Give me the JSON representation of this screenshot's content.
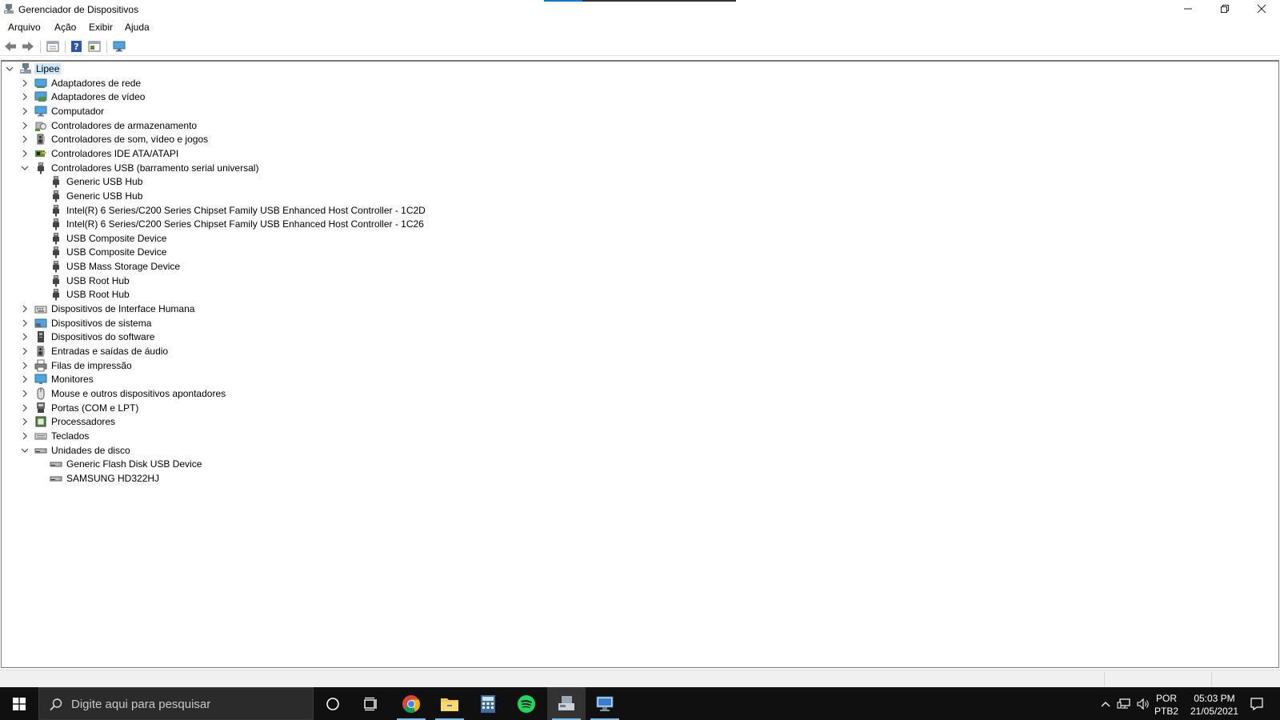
{
  "window": {
    "title": "Gerenciador de Dispositivos"
  },
  "menu": {
    "items": [
      "Arquivo",
      "Ação",
      "Exibir",
      "Ajuda"
    ]
  },
  "tree": {
    "root": "Lipee",
    "nodes": [
      {
        "label": "Adaptadores de rede",
        "level": 1,
        "expander": "collapsed",
        "icon": "network-adapter-icon"
      },
      {
        "label": "Adaptadores de vídeo",
        "level": 1,
        "expander": "collapsed",
        "icon": "display-adapter-icon"
      },
      {
        "label": "Computador",
        "level": 1,
        "expander": "collapsed",
        "icon": "computer-icon"
      },
      {
        "label": "Controladores de armazenamento",
        "level": 1,
        "expander": "collapsed",
        "icon": "storage-controller-icon"
      },
      {
        "label": "Controladores de som, vídeo e jogos",
        "level": 1,
        "expander": "collapsed",
        "icon": "speaker-icon"
      },
      {
        "label": "Controladores IDE ATA/ATAPI",
        "level": 1,
        "expander": "collapsed",
        "icon": "ide-controller-icon"
      },
      {
        "label": "Controladores USB (barramento serial universal)",
        "level": 1,
        "expander": "expanded",
        "icon": "usb-plug-icon"
      },
      {
        "label": "Generic USB Hub",
        "level": 2,
        "expander": "none",
        "icon": "usb-plug-icon"
      },
      {
        "label": "Generic USB Hub",
        "level": 2,
        "expander": "none",
        "icon": "usb-plug-icon"
      },
      {
        "label": "Intel(R) 6 Series/C200 Series Chipset Family USB Enhanced Host Controller - 1C2D",
        "level": 2,
        "expander": "none",
        "icon": "usb-plug-icon"
      },
      {
        "label": "Intel(R) 6 Series/C200 Series Chipset Family USB Enhanced Host Controller - 1C26",
        "level": 2,
        "expander": "none",
        "icon": "usb-plug-icon"
      },
      {
        "label": "USB Composite Device",
        "level": 2,
        "expander": "none",
        "icon": "usb-plug-icon"
      },
      {
        "label": "USB Composite Device",
        "level": 2,
        "expander": "none",
        "icon": "usb-plug-icon"
      },
      {
        "label": "USB Mass Storage Device",
        "level": 2,
        "expander": "none",
        "icon": "usb-plug-icon"
      },
      {
        "label": "USB Root Hub",
        "level": 2,
        "expander": "none",
        "icon": "usb-plug-icon"
      },
      {
        "label": "USB Root Hub",
        "level": 2,
        "expander": "none",
        "icon": "usb-plug-icon"
      },
      {
        "label": "Dispositivos de Interface Humana",
        "level": 1,
        "expander": "collapsed",
        "icon": "hid-keyboard-icon"
      },
      {
        "label": "Dispositivos de sistema",
        "level": 1,
        "expander": "collapsed",
        "icon": "system-device-icon"
      },
      {
        "label": "Dispositivos do software",
        "level": 1,
        "expander": "collapsed",
        "icon": "software-device-icon"
      },
      {
        "label": "Entradas e saídas de áudio",
        "level": 1,
        "expander": "collapsed",
        "icon": "speaker-icon"
      },
      {
        "label": "Filas de impressão",
        "level": 1,
        "expander": "collapsed",
        "icon": "printer-icon"
      },
      {
        "label": "Monitores",
        "level": 1,
        "expander": "collapsed",
        "icon": "monitor-icon"
      },
      {
        "label": "Mouse e outros dispositivos apontadores",
        "level": 1,
        "expander": "collapsed",
        "icon": "mouse-icon"
      },
      {
        "label": "Portas (COM e LPT)",
        "level": 1,
        "expander": "collapsed",
        "icon": "port-icon"
      },
      {
        "label": "Processadores",
        "level": 1,
        "expander": "collapsed",
        "icon": "processor-icon"
      },
      {
        "label": "Teclados",
        "level": 1,
        "expander": "collapsed",
        "icon": "keyboard-icon"
      },
      {
        "label": "Unidades de disco",
        "level": 1,
        "expander": "expanded",
        "icon": "disk-drive-icon"
      },
      {
        "label": "Generic Flash Disk USB Device",
        "level": 2,
        "expander": "none",
        "icon": "disk-drive-icon"
      },
      {
        "label": "SAMSUNG HD322HJ",
        "level": 2,
        "expander": "none",
        "icon": "disk-drive-icon"
      }
    ]
  },
  "taskbar": {
    "search_placeholder": "Digite aqui para pesquisar",
    "apps": [
      "cortana-icon",
      "task-view-icon",
      "chrome-icon",
      "file-explorer-icon",
      "calculator-icon",
      "spotify-icon",
      "device-manager-icon",
      "remote-desktop-icon"
    ],
    "language": "POR",
    "keyboard_layout": "PTB2",
    "time": "05:03 PM",
    "date": "21/05/2021"
  },
  "colors": {
    "accent": "#0078d7",
    "selection": "#cce8ff",
    "taskbar": "#101010"
  }
}
